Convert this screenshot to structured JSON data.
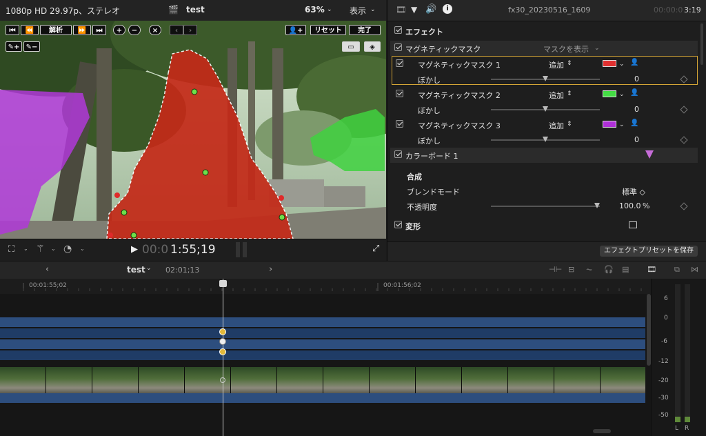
{
  "viewer": {
    "format": "1080p HD 29.97p、ステレオ",
    "project": "test",
    "zoom": "63%",
    "view_menu": "表示",
    "buttons": {
      "analyze": "解析",
      "reset": "リセット",
      "done": "完了"
    },
    "timecode_dim": "00:0",
    "timecode": "1:55;19"
  },
  "inspector": {
    "clip_name": "fx30_20230516_1609",
    "duration_dim": "00:00:0",
    "duration": "3:19",
    "effects_label": "エフェクト",
    "magnetic_mask": "マグネティックマスク",
    "show_mask": "マスクを表示",
    "masks": [
      {
        "name": "マグネティックマスク 1",
        "mode": "追加",
        "color": "#e03030",
        "blur_label": "ぼかし",
        "blur_value": "0",
        "selected": true
      },
      {
        "name": "マグネティックマスク 2",
        "mode": "追加",
        "color": "#44dd44",
        "blur_label": "ぼかし",
        "blur_value": "0",
        "selected": false
      },
      {
        "name": "マグネティックマスク 3",
        "mode": "追加",
        "color": "#b030d8",
        "blur_label": "ぼかし",
        "blur_value": "0",
        "selected": false
      }
    ],
    "color_board": "カラーボード 1",
    "composite": "合成",
    "blend_mode_label": "ブレンドモード",
    "blend_mode_value": "標準 ◇",
    "opacity_label": "不透明度",
    "opacity_value": "100.0",
    "opacity_unit": "%",
    "transform": "変形",
    "save_preset": "エフェクトプリセットを保存"
  },
  "timeline": {
    "project": "test",
    "duration": "02:01;13",
    "ruler": [
      "00:01:55;02",
      "00:01:56;02"
    ]
  },
  "meters": {
    "scale": [
      "6",
      "0",
      "-6",
      "-12",
      "-20",
      "-30",
      "-50"
    ],
    "channels": [
      "L",
      "R"
    ]
  }
}
